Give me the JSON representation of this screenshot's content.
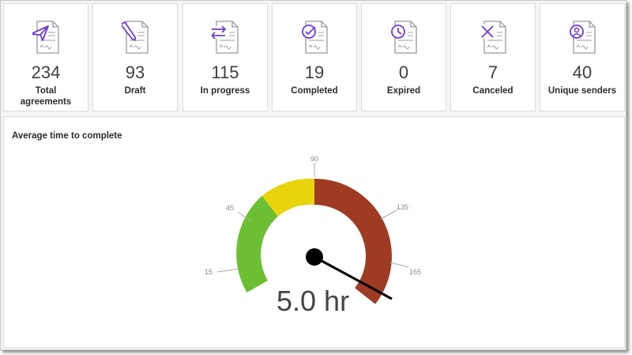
{
  "stats": [
    {
      "value": "234",
      "label": "Total agreements",
      "icon": "paper-plane-icon"
    },
    {
      "value": "93",
      "label": "Draft",
      "icon": "pencil-icon"
    },
    {
      "value": "115",
      "label": "In progress",
      "icon": "swap-arrows-icon"
    },
    {
      "value": "19",
      "label": "Completed",
      "icon": "check-circle-icon"
    },
    {
      "value": "0",
      "label": "Expired",
      "icon": "clock-icon"
    },
    {
      "value": "7",
      "label": "Canceled",
      "icon": "x-icon"
    },
    {
      "value": "40",
      "label": "Unique senders",
      "icon": "user-circle-icon"
    }
  ],
  "colors": {
    "icon_accent": "#6e3bd6",
    "green": "#6cbf32",
    "yellow": "#e8d40c",
    "red": "#9e3b22"
  },
  "gauge": {
    "title": "Average time to complete",
    "ticks": [
      "15",
      "45",
      "90",
      "135",
      "165"
    ],
    "readout": "5.0 hr",
    "value_hours": 5.0
  }
}
